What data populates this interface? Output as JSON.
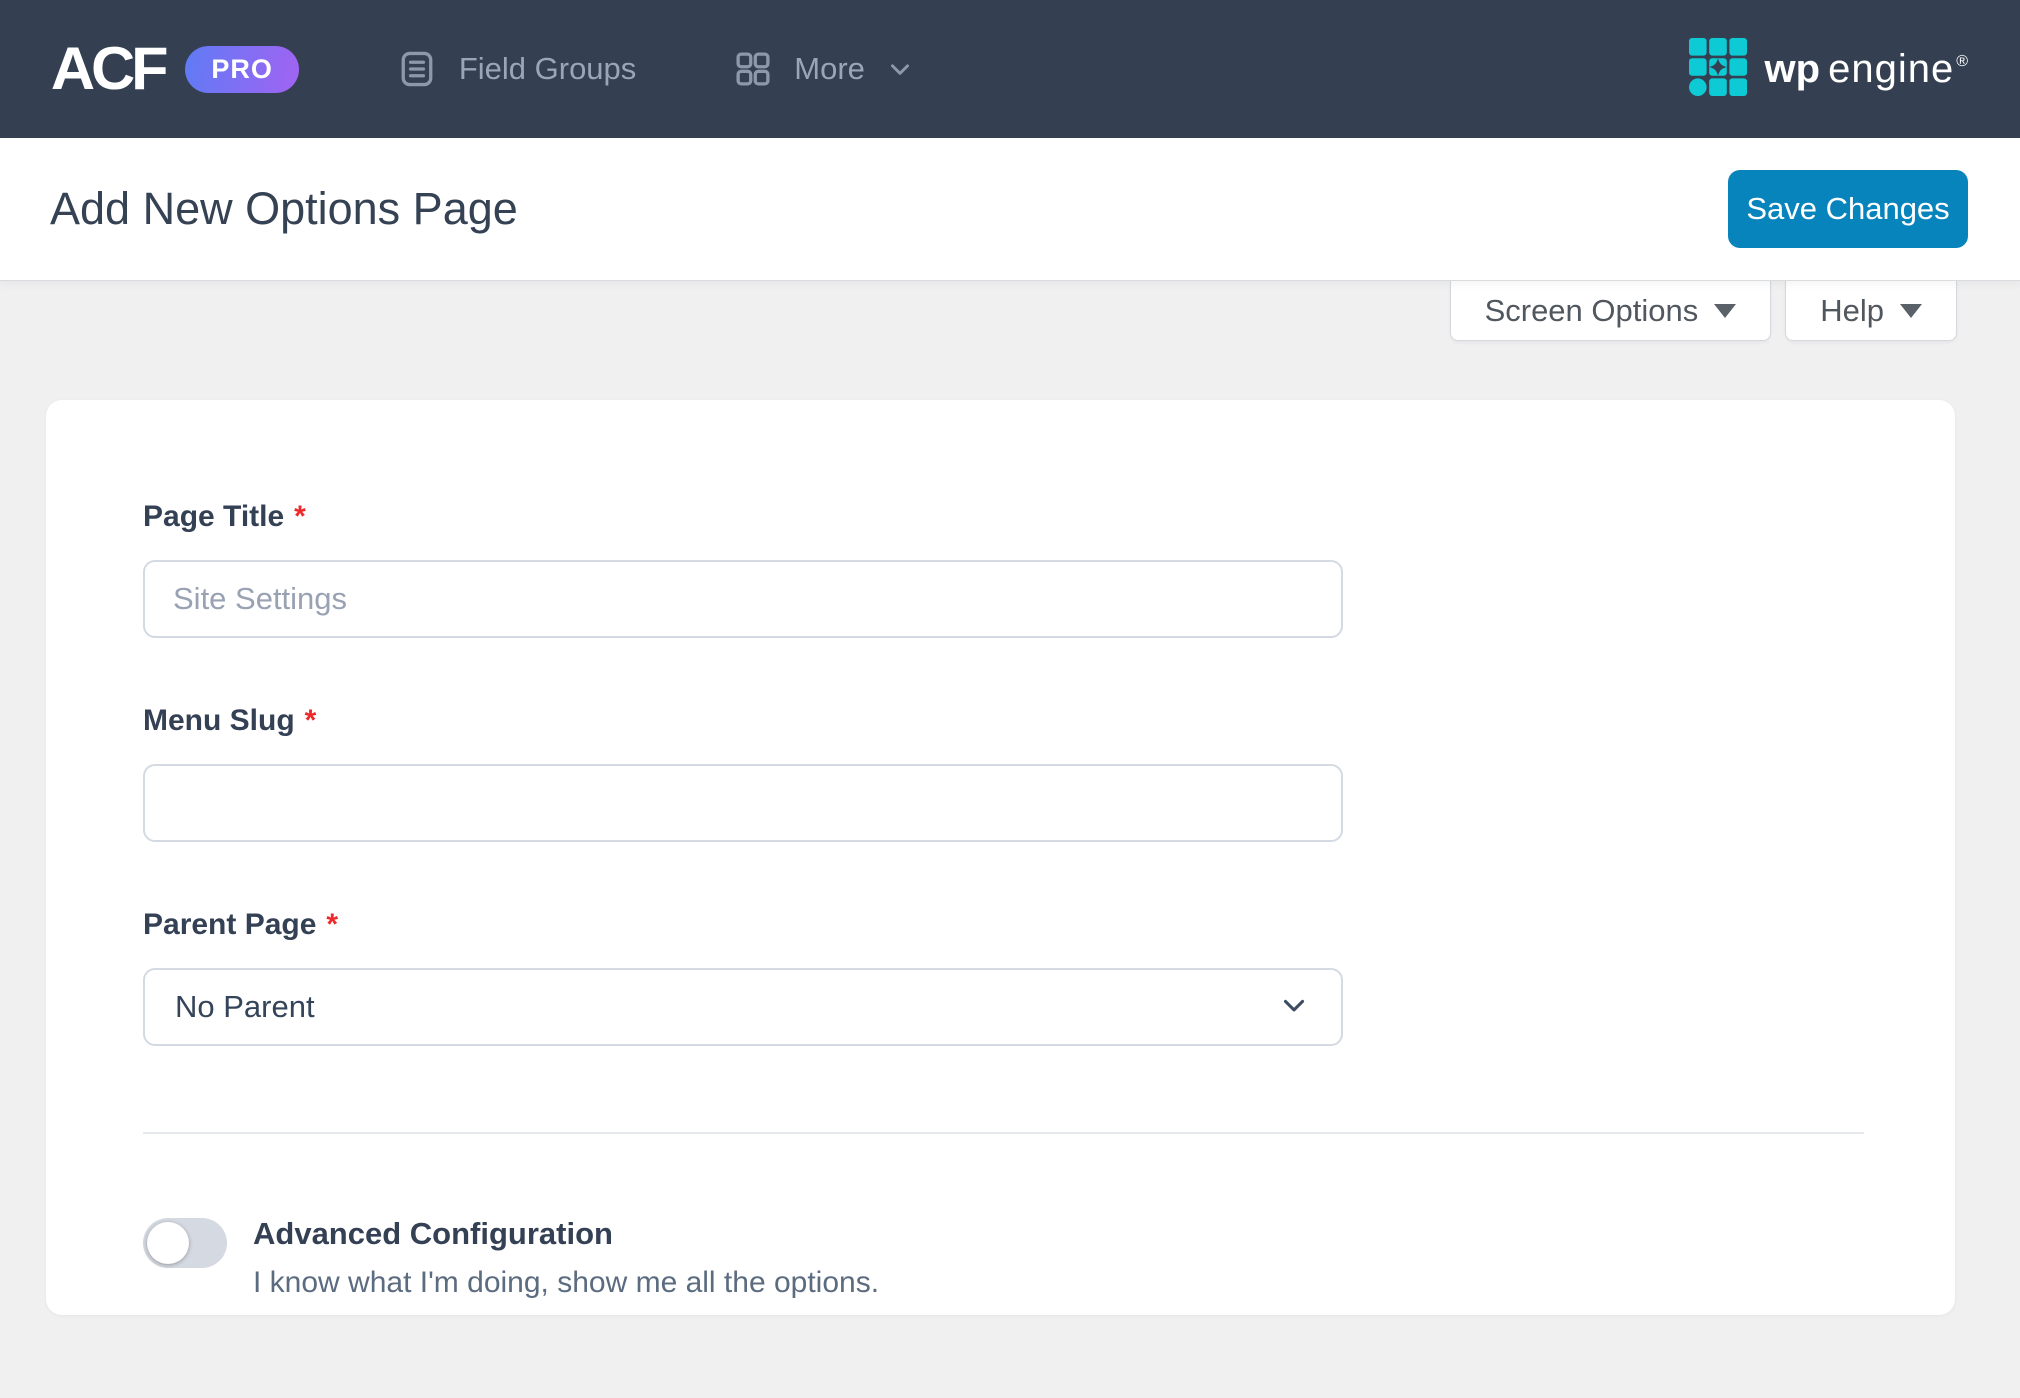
{
  "navbar": {
    "logo_text": "ACF",
    "badge": "PRO",
    "items": [
      {
        "label": "Field Groups"
      },
      {
        "label": "More"
      }
    ],
    "wpengine": {
      "wp": "wp",
      "engine": "engine",
      "reg": "®"
    }
  },
  "header": {
    "title": "Add New Options Page",
    "save_label": "Save Changes"
  },
  "tabs": {
    "screen_options": "Screen Options",
    "help": "Help"
  },
  "form": {
    "page_title": {
      "label": "Page Title",
      "required": "*",
      "placeholder": "Site Settings",
      "value": ""
    },
    "menu_slug": {
      "label": "Menu Slug",
      "required": "*",
      "placeholder": "",
      "value": ""
    },
    "parent_page": {
      "label": "Parent Page",
      "required": "*",
      "selected": "No Parent"
    },
    "advanced": {
      "label": "Advanced Configuration",
      "description": "I know what I'm doing, show me all the options.",
      "enabled": false
    }
  },
  "colors": {
    "navbar_bg": "#344051",
    "accent_blue": "#0884bd",
    "pro_gradient_start": "#5f7bf5",
    "pro_gradient_end": "#a263f2",
    "wpengine_cyan": "#0ecad4",
    "required_red": "#ef2929",
    "page_bg": "#f0f0f1"
  }
}
